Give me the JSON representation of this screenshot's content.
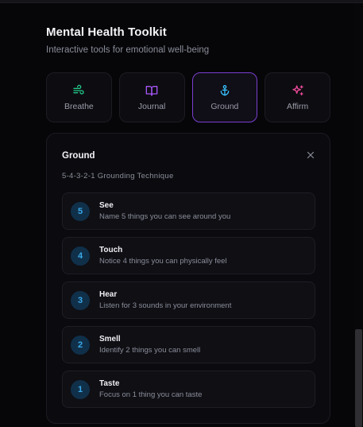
{
  "header": {
    "title": "Mental Health Toolkit",
    "subtitle": "Interactive tools for emotional well-being"
  },
  "tools": [
    {
      "label": "Breathe",
      "icon": "wind-icon",
      "color": "#22c98a"
    },
    {
      "label": "Journal",
      "icon": "book-open-icon",
      "color": "#a855f7"
    },
    {
      "label": "Ground",
      "icon": "anchor-icon",
      "color": "#38bdf8",
      "active": true
    },
    {
      "label": "Affirm",
      "icon": "sparkles-icon",
      "color": "#ec4899"
    }
  ],
  "panel": {
    "title": "Ground",
    "subtitle": "5-4-3-2-1 Grounding Technique",
    "close_icon": "close-icon",
    "steps": [
      {
        "number": "5",
        "name": "See",
        "description": "Name 5 things you can see around you"
      },
      {
        "number": "4",
        "name": "Touch",
        "description": "Notice 4 things you can physically feel"
      },
      {
        "number": "3",
        "name": "Hear",
        "description": "Listen for 3 sounds in your environment"
      },
      {
        "number": "2",
        "name": "Smell",
        "description": "Identify 2 things you can smell"
      },
      {
        "number": "1",
        "name": "Taste",
        "description": "Focus on 1 thing you can taste"
      }
    ]
  },
  "colors": {
    "accent_active_border": "#7a3fd0",
    "step_number": "#3aa8e8",
    "step_number_bg": "#10304a"
  }
}
